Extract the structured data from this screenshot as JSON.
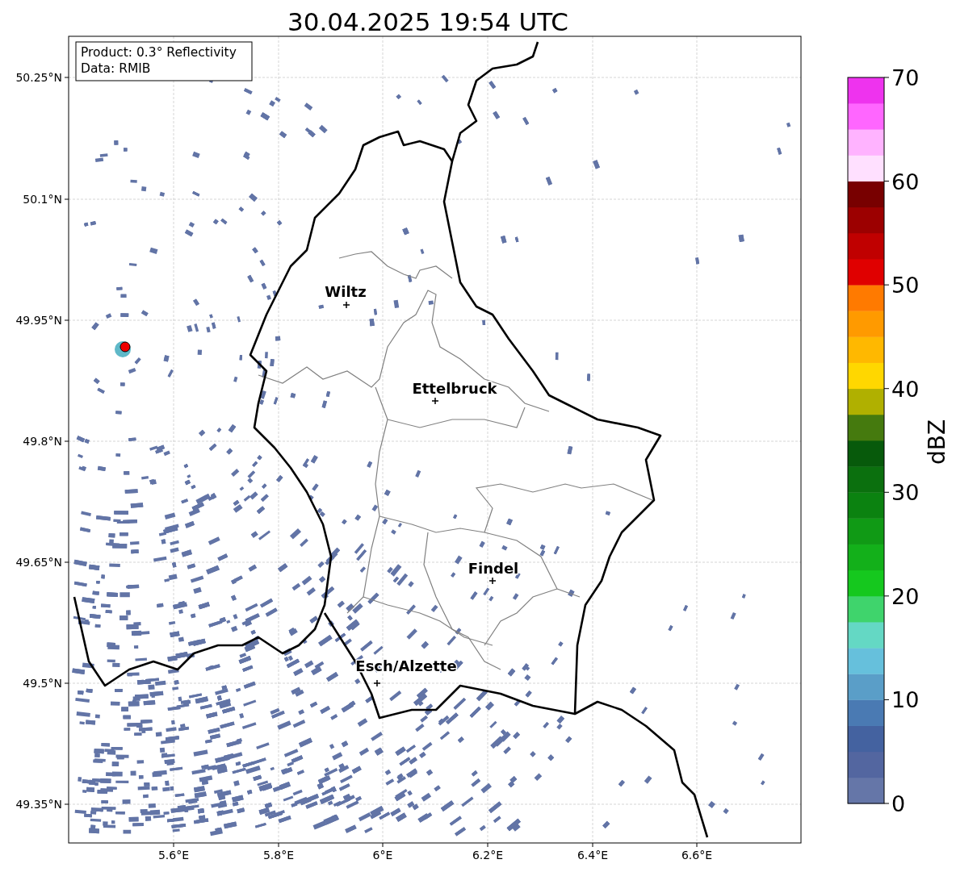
{
  "title": "30.04.2025 19:54 UTC",
  "info_box": {
    "lines": [
      "Product: 0.3° Reflectivity",
      "Data: RMIB"
    ]
  },
  "map": {
    "y_ticks": [
      "50.25°N",
      "50.1°N",
      "49.95°N",
      "49.8°N",
      "49.65°N",
      "49.5°N",
      "49.35°N"
    ],
    "x_ticks": [
      "5.6°E",
      "5.8°E",
      "6°E",
      "6.2°E",
      "6.4°E",
      "6.6°E"
    ]
  },
  "cities": [
    {
      "name": "Wiltz"
    },
    {
      "name": "Ettelbruck"
    },
    {
      "name": "Findel"
    },
    {
      "name": "Esch/Alzette"
    }
  ],
  "colorbar": {
    "label": "dBZ",
    "ticks": [
      "70",
      "60",
      "50",
      "40",
      "30",
      "20",
      "10",
      "0"
    ],
    "segments": [
      {
        "color": "#6576a8"
      },
      {
        "color": "#5366a0"
      },
      {
        "color": "#4462a0"
      },
      {
        "color": "#4a7ab3"
      },
      {
        "color": "#5a9ec8"
      },
      {
        "color": "#66c0dc"
      },
      {
        "color": "#64d8c4"
      },
      {
        "color": "#3fd46c"
      },
      {
        "color": "#15c81e"
      },
      {
        "color": "#13b01a"
      },
      {
        "color": "#109a15"
      },
      {
        "color": "#0b8210"
      },
      {
        "color": "#0b700e"
      },
      {
        "color": "#075a0b"
      },
      {
        "color": "#457a0e"
      },
      {
        "color": "#b0b000"
      },
      {
        "color": "#ffd700"
      },
      {
        "color": "#ffb800"
      },
      {
        "color": "#ff9a00"
      },
      {
        "color": "#ff7a00"
      },
      {
        "color": "#e00000"
      },
      {
        "color": "#c00000"
      },
      {
        "color": "#9c0000"
      },
      {
        "color": "#780000"
      },
      {
        "color": "#ffe0ff"
      },
      {
        "color": "#ffb3ff"
      },
      {
        "color": "#ff66ff"
      },
      {
        "color": "#ee33ee"
      }
    ]
  }
}
